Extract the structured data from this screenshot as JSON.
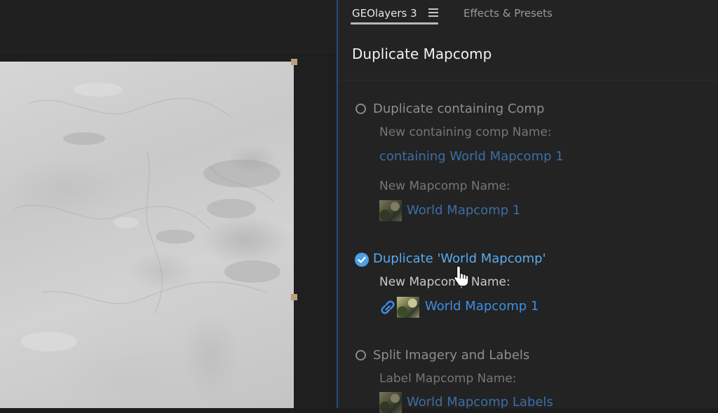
{
  "tabs": [
    {
      "label": "GEOlayers 3",
      "active": true
    },
    {
      "label": "Effects & Presets",
      "active": false
    }
  ],
  "panel": {
    "title": "Duplicate Mapcomp"
  },
  "options": [
    {
      "label": "Duplicate containing Comp",
      "selected": false,
      "fields": [
        {
          "label": "New containing comp Name:",
          "value": "containing World Mapcomp 1"
        },
        {
          "label": "New Mapcomp Name:",
          "value": "World Mapcomp 1"
        }
      ]
    },
    {
      "label": "Duplicate 'World Mapcomp'",
      "selected": true,
      "fields": [
        {
          "label": "New Mapcomp Name:",
          "value": "World Mapcomp 1"
        }
      ]
    },
    {
      "label": "Split Imagery and Labels",
      "selected": false,
      "fields": [
        {
          "label": "Label Mapcomp Name:",
          "value": "World Mapcomp Labels"
        }
      ]
    }
  ],
  "colors": {
    "accent": "#4e9fe6",
    "link": "#3b8fe8",
    "panel_bg": "#232323",
    "divider": "#2a4d7a"
  },
  "icons": {
    "menu": "hamburger-menu-icon",
    "check": "check-circle-icon",
    "chain": "link-icon",
    "thumbnail": "map-thumbnail-icon",
    "cursor": "hand-pointer-icon"
  }
}
